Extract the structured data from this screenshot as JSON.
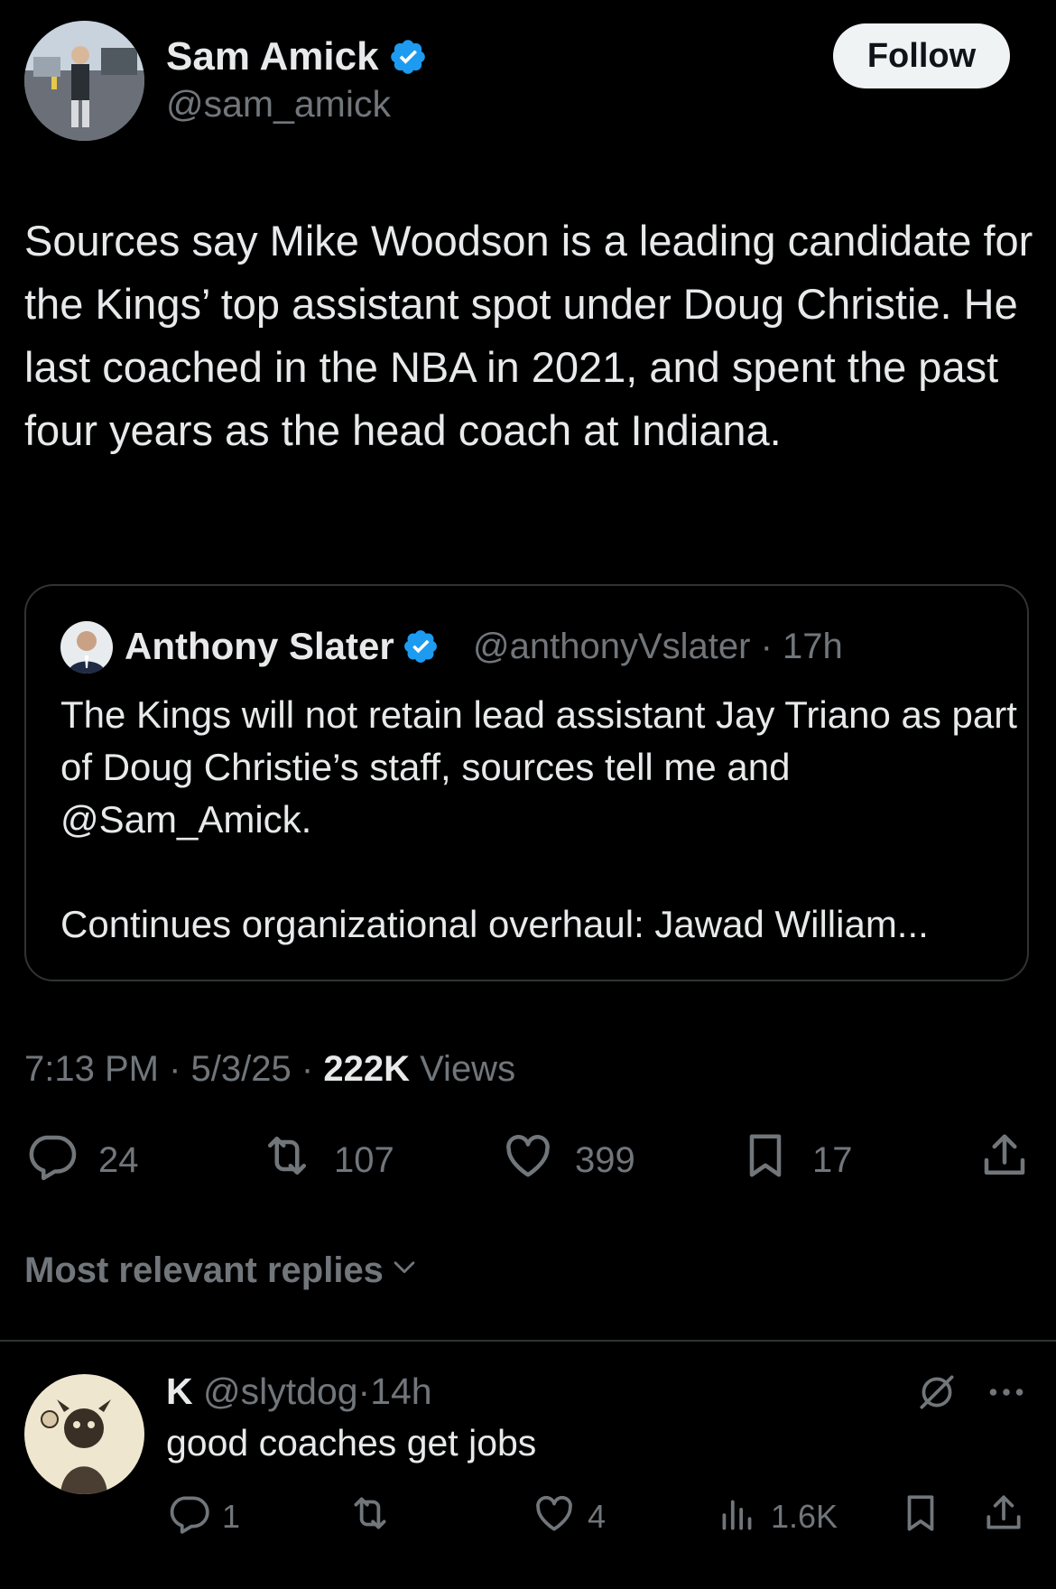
{
  "post": {
    "author": {
      "name": "Sam Amick",
      "handle": "@sam_amick",
      "verified": true
    },
    "follow_label": "Follow",
    "text": "Sources say Mike Woodson is a leading candidate for the Kings’ top assistant spot under Doug Christie. He last coached in the NBA in 2021, and spent the past four years as the head coach at Indiana.",
    "quote": {
      "author_name": "Anthony Slater",
      "handle": "@anthonyVslater",
      "separator": "·",
      "time": "17h",
      "text": "The Kings will not retain lead assistant Jay Triano as part of Doug Christie’s staff, sources tell me and @Sam_Amick.\n\nContinues organizational overhaul: Jawad William..."
    },
    "meta": {
      "time": "7:13 PM",
      "date": "5/3/25",
      "separator": "·",
      "views_count": "222K",
      "views_label": "Views"
    },
    "actions": {
      "replies": "24",
      "reposts": "107",
      "likes": "399",
      "bookmarks": "17"
    }
  },
  "replies_sort_label": "Most relevant replies",
  "reply": {
    "name": "K",
    "handle": "@slytdog",
    "separator": "·",
    "time": "14h",
    "text": "good coaches get jobs",
    "actions": {
      "replies": "1",
      "likes": "4",
      "views": "1.6K"
    }
  },
  "colors": {
    "background": "#000000",
    "text_primary": "#e7e9ea",
    "text_secondary": "#71767b",
    "verified_blue": "#1d9bf0",
    "border": "#2f3336",
    "follow_bg": "#eff3f4"
  },
  "icons": [
    "verified-badge-icon",
    "reply-icon",
    "repost-icon",
    "like-icon",
    "bookmark-icon",
    "share-icon",
    "chevron-down-icon",
    "grok-icon",
    "more-icon",
    "views-icon"
  ]
}
